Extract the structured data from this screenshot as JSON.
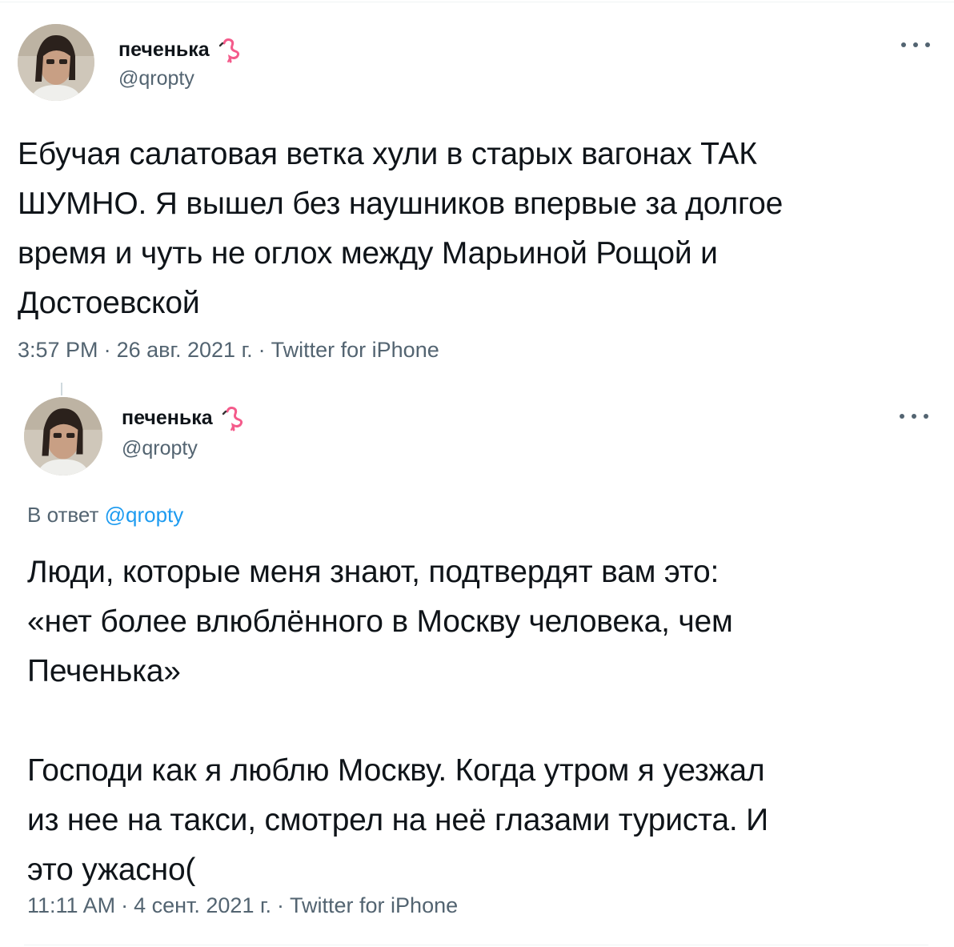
{
  "tweets": [
    {
      "name": "печенька",
      "handle": "@qropty",
      "text": "Ебучая салатовая ветка хули в старых вагонах ТАК\nШУМНО. Я вышел без наушников впервые за долгое\nвремя и чуть не оглох между Марьиной Рощой и\nДостоевской",
      "time": "3:57 PM",
      "date": "26 авг. 2021 г.",
      "source": "Twitter for iPhone"
    },
    {
      "name": "печенька",
      "handle": "@qropty",
      "reply_prefix": "В ответ",
      "reply_to": "@qropty",
      "text": "Люди, которые меня знают, подтвердят вам это:\n«нет более влюблённого в Москву человека, чем\nПеченька»\n\nГосподи как я люблю Москву. Когда утром я уезжал\nиз нее на такси, смотрел на неё глазами туриста. И\nэто ужасно(",
      "time": "11:11 AM",
      "date": "4 сент. 2021 г.",
      "source": "Twitter for iPhone"
    }
  ],
  "separator": "·",
  "icons": {
    "name_badge": "flamingo-icon",
    "menu": "more-options-icon"
  },
  "colors": {
    "text": "#0f1419",
    "secondary": "#536471",
    "link": "#1d9bf0",
    "flamingo": "#f45b8b"
  }
}
